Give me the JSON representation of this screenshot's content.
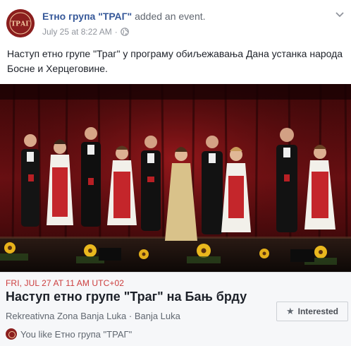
{
  "header": {
    "page_name": "Етно група \"ТРАГ\"",
    "action": " added an event.",
    "timestamp": "July 25 at 8:22 AM",
    "separator": "·",
    "privacy_icon": "globe-icon",
    "avatar_logo_text": "ТРАГ",
    "colors": {
      "name": "#365899",
      "brand": "#8b1e1e"
    }
  },
  "post": {
    "text": "Наступ етно групе \"Траг\" у програму обиљежавања Дана устанка народа Босне и Херцеговине."
  },
  "photo": {
    "subject": "stage-performance-photo"
  },
  "event": {
    "date": "FRI, JUL 27 AT 11 AM UTC+02",
    "title": "Наступ етно групе \"Траг\" на Бањ брду",
    "location": "Rekreativna Zona Banja Luka · Banja Luka",
    "interested_label": "Interested",
    "interested_icon": "star-icon",
    "you_like": "You like Етно група \"ТРАГ\"",
    "colors": {
      "date": "#cc3d3d",
      "card_bg": "#f6f7f9"
    }
  }
}
